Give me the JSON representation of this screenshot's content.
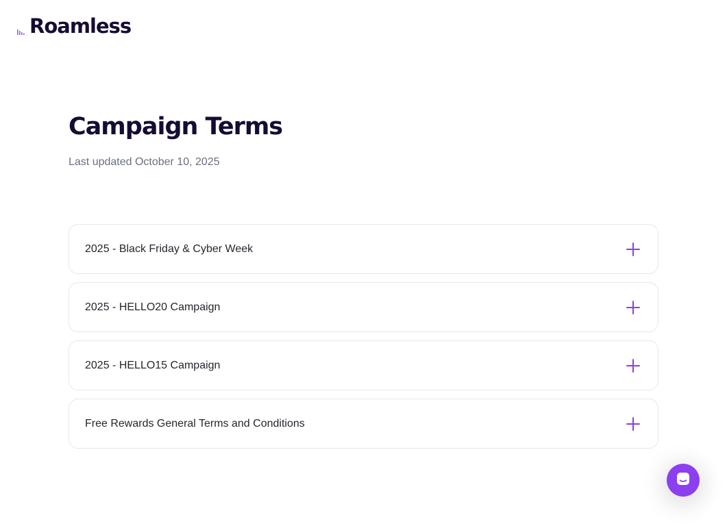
{
  "brand": {
    "name": "Roamless",
    "logo_icon": "roamless-logo-icon",
    "accent_color": "#8b3fe6",
    "text_color": "#160c33"
  },
  "page": {
    "title": "Campaign Terms",
    "last_updated": "Last updated October 10, 2025"
  },
  "accordion": {
    "items": [
      {
        "label": "2025 - Black Friday & Cyber Week",
        "icon": "plus-icon",
        "expanded": false
      },
      {
        "label": "2025 - HELLO20 Campaign",
        "icon": "plus-icon",
        "expanded": false
      },
      {
        "label": "2025 - HELLO15 Campaign",
        "icon": "plus-icon",
        "expanded": false
      },
      {
        "label": "Free Rewards General Terms and Conditions",
        "icon": "plus-icon",
        "expanded": false
      }
    ]
  },
  "chat": {
    "icon": "chat-bubble-icon",
    "color": "#8b3ff0"
  }
}
